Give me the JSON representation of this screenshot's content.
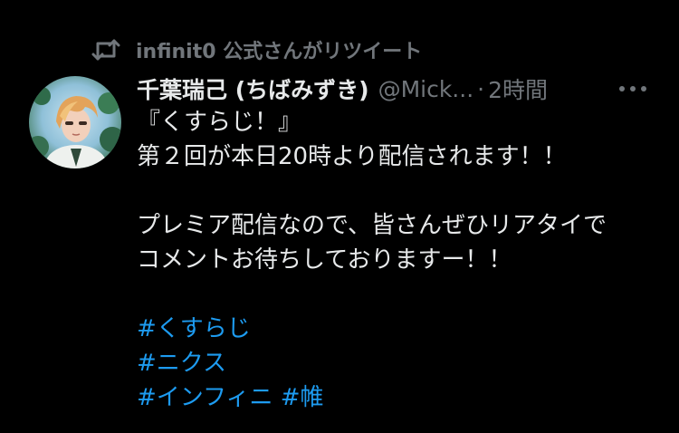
{
  "retweet": {
    "icon": "retweet-icon",
    "text": "infinit0 公式さんがリツイート"
  },
  "tweet": {
    "display_name": "千葉瑞己 (ちばみずき)",
    "handle": "@Mick...",
    "separator": "·",
    "time": "2時間",
    "more_icon": "more-horizontal-icon",
    "lines": [
      "『くすらじ！』",
      "第２回が本日20時より配信されます！！",
      "プレミア配信なので、皆さんぜひリアタイで",
      "コメントお待ちしておりますー！！"
    ],
    "hashtags": {
      "h1": "#くすらじ",
      "h2": "#ニクス",
      "h3": "#インフィニ",
      "h4": "#帷"
    }
  },
  "colors": {
    "background": "#000000",
    "text": "#e7e9ea",
    "muted": "#71767b",
    "link": "#1d9bf0"
  }
}
